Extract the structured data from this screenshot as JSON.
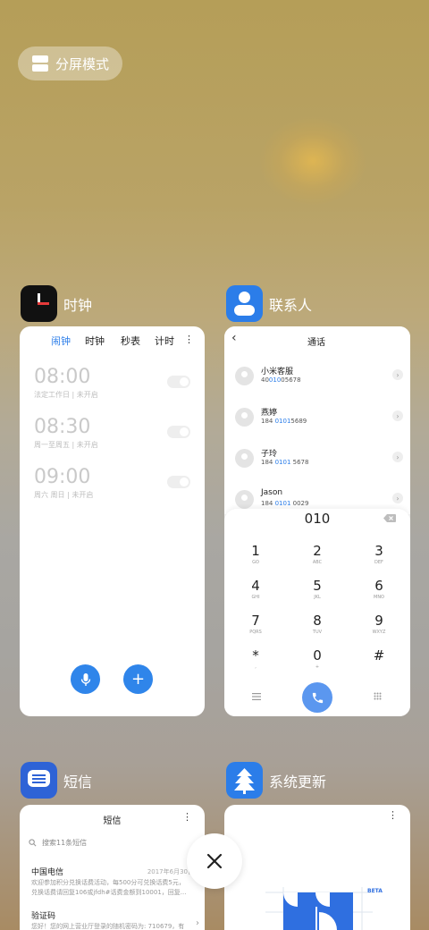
{
  "split_mode": {
    "label": "分屏模式"
  },
  "apps": {
    "clock": {
      "name": "时钟",
      "tabs": [
        "闹钟",
        "时钟",
        "秒表",
        "计时"
      ],
      "more": "⋮",
      "alarms": [
        {
          "time": "08:00",
          "sub": "法定工作日 | 未开启"
        },
        {
          "time": "08:30",
          "sub": "周一至周五 | 未开启"
        },
        {
          "time": "09:00",
          "sub": "周六 周日 | 未开启"
        }
      ],
      "add": "+"
    },
    "contacts": {
      "name": "联系人",
      "header": "通话",
      "back": "‹",
      "entries": [
        {
          "name": "小米客服",
          "num_a": "40",
          "num_hl": "010",
          "num_b": "05678"
        },
        {
          "name": "燕婷",
          "num_a": "184 ",
          "num_hl": "0101",
          "num_b": "5689"
        },
        {
          "name": "子玲",
          "num_a": "184 ",
          "num_hl": "0101",
          "num_b": " 5678"
        },
        {
          "name": "Jason",
          "num_a": "184 ",
          "num_hl": "0101",
          "num_b": " 0029"
        }
      ],
      "dial_input": "010",
      "keys": [
        {
          "d": "1",
          "l": "GO"
        },
        {
          "d": "2",
          "l": "ABC"
        },
        {
          "d": "3",
          "l": "DEF"
        },
        {
          "d": "4",
          "l": "GHI"
        },
        {
          "d": "5",
          "l": "JKL"
        },
        {
          "d": "6",
          "l": "MNO"
        },
        {
          "d": "7",
          "l": "PQRS"
        },
        {
          "d": "8",
          "l": "TUV"
        },
        {
          "d": "9",
          "l": "WXYZ"
        },
        {
          "d": "*",
          "l": ","
        },
        {
          "d": "0",
          "l": "+"
        },
        {
          "d": "#",
          "l": ""
        }
      ]
    },
    "sms": {
      "name": "短信",
      "header": "短信",
      "search_placeholder": "搜索11条短信",
      "messages": [
        {
          "sender": "中国电信",
          "date": "2017年6月30日",
          "body1": "欢迎参加积分兑换话费活动，每500分可兑换话费5元，",
          "body2": "兑换话费请回复106或jfdh#话费金额到10001，回复..."
        },
        {
          "sender": "验证码",
          "body1": "您好！您的网上营业厅登录的随机密码为: 710679，有"
        }
      ]
    },
    "update": {
      "name": "系统更新",
      "beta": "BETA"
    }
  },
  "icons": {
    "close": "close-icon",
    "mic": "microphone-icon",
    "phone": "phone-icon",
    "search": "search-icon"
  },
  "colors": {
    "accent": "#2f85ea",
    "clock_tab_active": "#2b7de9"
  }
}
